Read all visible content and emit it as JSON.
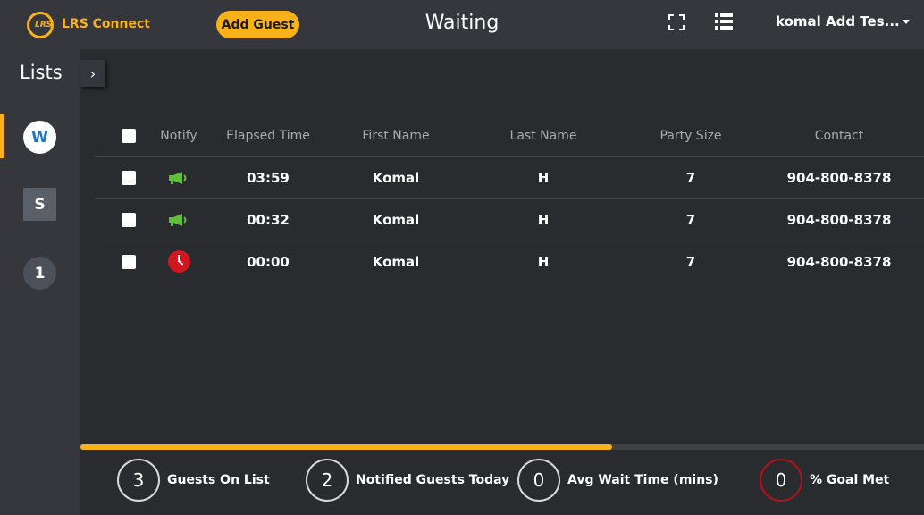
{
  "header": {
    "logo_text": "LRS",
    "brand": "LRS Connect",
    "add_guest_label": "Add Guest",
    "title": "Waiting",
    "user_menu": "komal Add Tes...",
    "accent_color": "#f8b118"
  },
  "sidebar": {
    "title": "Lists",
    "toggle": "›",
    "items": [
      {
        "label": "W",
        "active": true
      },
      {
        "label": "S",
        "active": false
      },
      {
        "label": "1",
        "active": false
      }
    ]
  },
  "table": {
    "columns": [
      "Notify",
      "Elapsed Time",
      "First Name",
      "Last Name",
      "Party Size",
      "Contact"
    ],
    "rows": [
      {
        "notify_icon": "megaphone-icon",
        "elapsed": "03:59",
        "first": "Komal",
        "last": "H",
        "party": "7",
        "contact": "904-800-8378"
      },
      {
        "notify_icon": "megaphone-icon",
        "elapsed": "00:32",
        "first": "Komal",
        "last": "H",
        "party": "7",
        "contact": "904-800-8378"
      },
      {
        "notify_icon": "clock-icon",
        "elapsed": "00:00",
        "first": "Komal",
        "last": "H",
        "party": "7",
        "contact": "904-800-8378"
      }
    ]
  },
  "progress": {
    "fraction": 0.63
  },
  "stats": [
    {
      "value": "3",
      "label": "Guests On List"
    },
    {
      "value": "2",
      "label": "Notified Guests Today"
    },
    {
      "value": "0",
      "label": "Avg Wait Time (mins)"
    },
    {
      "value": "0",
      "label": "% Goal Met"
    }
  ],
  "colors": {
    "notify_green": "#5bc236",
    "alert_red": "#d0161f",
    "goal_ring": "#b3121a"
  }
}
